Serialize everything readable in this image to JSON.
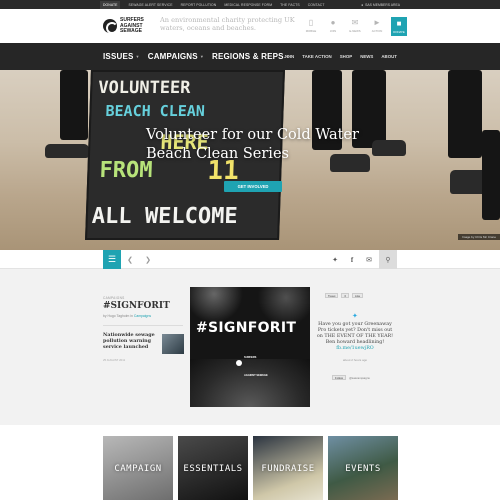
{
  "utility_bar": {
    "links": [
      "DONATE",
      "SEWAGE ALERT SERVICE",
      "REPORT POLLUTION",
      "MEDICAL RESPONSE FORM",
      "THE FACTS",
      "CONTACT"
    ],
    "members_label": "SAS MEMBERS AREA"
  },
  "header": {
    "logo_line1": "SURFERS",
    "logo_line2": "AGAINST",
    "logo_line3": "SEWAGE",
    "tagline": "An environmental charity protecting UK waters, oceans and beaches.",
    "icons": [
      {
        "label": "MOBILE",
        "icon": "mobile-icon"
      },
      {
        "label": "JOIN",
        "icon": "person-icon"
      },
      {
        "label": "E-NEWS",
        "icon": "envelope-icon"
      },
      {
        "label": "ACTION",
        "icon": "megaphone-icon"
      },
      {
        "label": "DONATE",
        "icon": "gift-icon"
      }
    ]
  },
  "nav": {
    "main": [
      "ISSUES",
      "CAMPAIGNS",
      "REGIONS & REPS"
    ],
    "sub": [
      "JOIN",
      "TAKE ACTION",
      "SHOP",
      "NEWS",
      "ABOUT"
    ]
  },
  "hero": {
    "board_lines": [
      "VOLUNTEER",
      "BEACH CLEAN",
      "HERE",
      "FROM",
      "11",
      "ALL WELCOME"
    ],
    "title": "Volunteer for our Cold Water Beach Clean Series",
    "cta": "GET INVOLVED",
    "credit": "Image by Chris Mc Crane"
  },
  "toolbar": {
    "menu_icon": "menu-icon",
    "social": [
      "twitter-icon",
      "facebook-icon",
      "email-icon"
    ],
    "search_icon": "search-icon"
  },
  "feature": {
    "category": "CAMPAIGNS",
    "title": "#SIGNFORIT",
    "meta_by": "by Hugo Tagholm",
    "meta_in": "in",
    "meta_category": "Campaigns",
    "mini_title": "Nationwide sewage pollution warning service launched",
    "mini_date": "25 AUGUST 2011",
    "poster_text": "#SIGNFORIT",
    "poster_logo_line1": "SURFERS",
    "poster_logo_line2": "AGAINST SEWAGE"
  },
  "twitter": {
    "tweet_btn": "Tweet",
    "count": "0",
    "like_btn": "Like",
    "tweet_text": "Have you got your Greenaway Pro tickets yet? Don't miss out on THE EVENT OF THE YEAR! Ben howard headlining!",
    "tweet_link": "fb.me/1uewjRO",
    "tweet_time": "about 2 hours ago",
    "follow_btn": "Follow",
    "handle": "@sascampaigns"
  },
  "tiles": [
    "CAMPAIGN",
    "ESSENTIALS",
    "FUNDRAISE",
    "EVENTS"
  ],
  "colors": {
    "accent": "#1fa3b2",
    "nav_bg": "#262626",
    "utility_bg": "#2a2a2a"
  }
}
